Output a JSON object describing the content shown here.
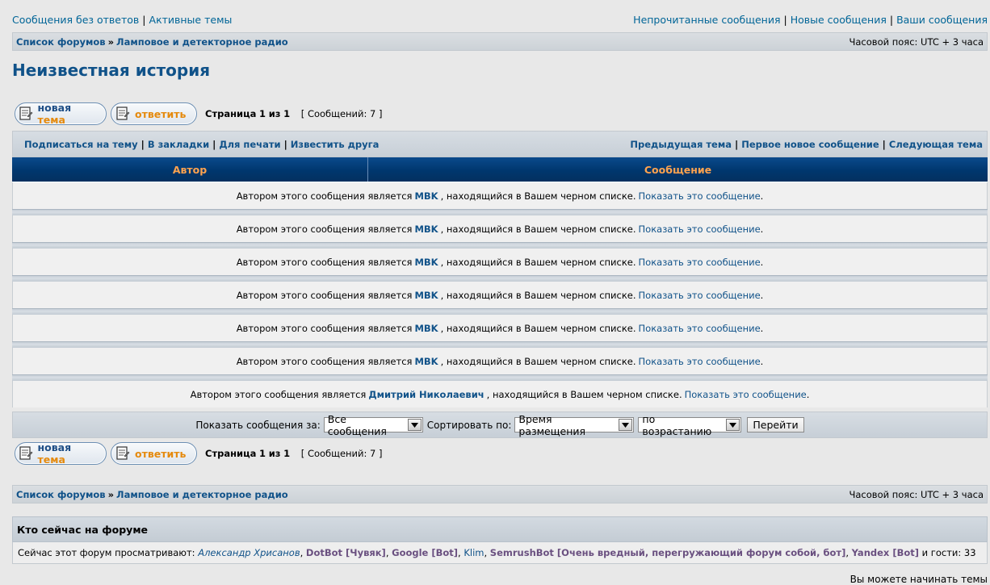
{
  "top_links": {
    "left": [
      "Сообщения без ответов",
      "Активные темы"
    ],
    "right": [
      "Непрочитанные сообщения",
      "Новые сообщения",
      "Ваши сообщения"
    ]
  },
  "breadcrumb": {
    "forum_index": "Список форумов",
    "forum": "Ламповое и детекторное радио",
    "separator": "»",
    "timezone": "Часовой пояс: UTC + 3 часа"
  },
  "topic_title": "Неизвестная история",
  "buttons": {
    "new_topic_a": "новая",
    "new_topic_b": "тема",
    "reply": "ответить"
  },
  "pagination": {
    "page_label": "Страница",
    "current": "1",
    "of_label": "из",
    "total": "1",
    "posts_count": "[ Сообщений: 7 ]"
  },
  "topic_actions": {
    "left": [
      "Подписаться на тему",
      "В закладки",
      "Для печати",
      "Известить друга"
    ],
    "right": [
      "Предыдущая тема",
      "Первое новое сообщение",
      "Следующая тема"
    ]
  },
  "table_head": {
    "author": "Автор",
    "message": "Сообщение"
  },
  "blocked_text": {
    "prefix": "Автором этого сообщения является",
    "suffix": ", находящийся в Вашем черном списке.",
    "show_link": "Показать это сообщение",
    "end": "."
  },
  "posts": [
    {
      "author": "MBK"
    },
    {
      "author": "MBK"
    },
    {
      "author": "MBK"
    },
    {
      "author": "MBK"
    },
    {
      "author": "MBK"
    },
    {
      "author": "MBK"
    },
    {
      "author": "Дмитрий Николаевич"
    }
  ],
  "filter": {
    "show_label": "Показать сообщения за:",
    "show_value": "Все сообщения",
    "sort_label": "Сортировать по:",
    "sort_value": "Время размещения",
    "order_value": "по возрастанию",
    "go": "Перейти"
  },
  "who_online": {
    "title": "Кто сейчас на форуме",
    "prefix": "Сейчас этот форум просматривают:",
    "users": [
      {
        "name": "Александр Хрисанов",
        "kind": "reg"
      },
      {
        "name": "DotBot [Чувяк]",
        "kind": "bot"
      },
      {
        "name": "Google [Bot]",
        "kind": "bot"
      },
      {
        "name": "Klim",
        "kind": "plain"
      },
      {
        "name": "SemrushBot [Очень вредный, перегружающий форум собой, бот]",
        "kind": "bot"
      },
      {
        "name": "Yandex [Bot]",
        "kind": "bot"
      }
    ],
    "guests": "и гости: 33"
  },
  "footer_cut": "Вы можете начинать темы",
  "colors": {
    "link": "#105289",
    "header_bg": "#00376e",
    "header_text": "#ffa34f"
  }
}
